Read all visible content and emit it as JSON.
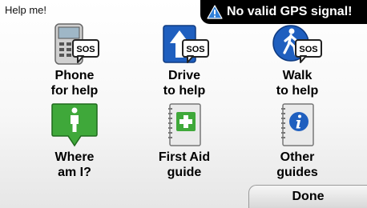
{
  "header": {
    "title": "Help me!"
  },
  "gps_banner": {
    "text": "No valid GPS signal!",
    "icon": "warning-icon"
  },
  "tiles": [
    {
      "line1": "Phone",
      "line2": "for help",
      "icon": "phone-sos-icon"
    },
    {
      "line1": "Drive",
      "line2": "to help",
      "icon": "drive-sos-icon"
    },
    {
      "line1": "Walk",
      "line2": "to help",
      "icon": "walk-sos-icon"
    },
    {
      "line1": "Where",
      "line2": "am I?",
      "icon": "where-am-i-icon"
    },
    {
      "line1": "First Aid",
      "line2": "guide",
      "icon": "first-aid-guide-icon"
    },
    {
      "line1": "Other",
      "line2": "guides",
      "icon": "other-guides-icon"
    }
  ],
  "sos_badge": "SOS",
  "footer": {
    "done_label": "Done"
  }
}
